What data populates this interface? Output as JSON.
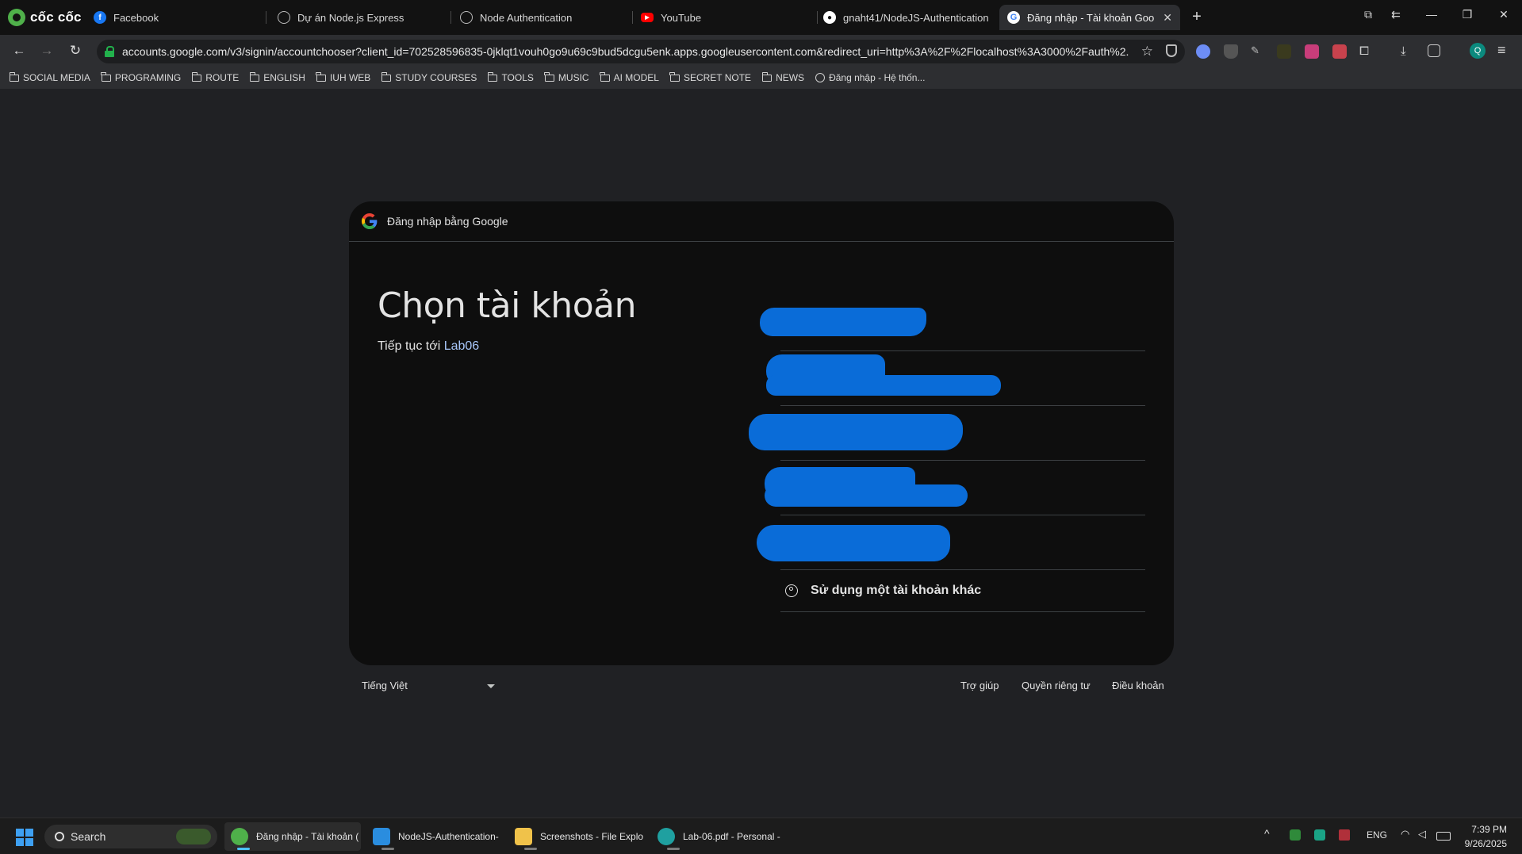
{
  "browser": {
    "brand": "cốc cốc",
    "tabs": [
      {
        "title": "Facebook",
        "icon": "facebook-icon",
        "color": "#1877f2"
      },
      {
        "title": "Dự án Node.js Express",
        "icon": "openai-icon",
        "color": "#9a9a9a"
      },
      {
        "title": "Node Authentication",
        "icon": "globe-icon",
        "color": "#9a9a9a"
      },
      {
        "title": "YouTube",
        "icon": "youtube-icon",
        "color": "#ff0000"
      },
      {
        "title": "gnaht41/NodeJS-Authentication",
        "icon": "github-icon",
        "color": "#ffffff"
      },
      {
        "title": "Đăng nhập - Tài khoản Goo",
        "icon": "google-icon",
        "color": "#ffffff",
        "active": true
      }
    ],
    "url": "accounts.google.com/v3/signin/accountchooser?client_id=702528596835-0jklqt1vouh0go9u69c9bud5dcgu5enk.apps.googleusercontent.com&redirect_uri=http%3A%2F%2Flocalhost%3A3000%2Fauth%2...",
    "avatar_letter": "Q",
    "bookmarks": [
      "SOCIAL MEDIA",
      "PROGRAMING",
      "ROUTE",
      "ENGLISH",
      "IUH WEB",
      "STUDY COURSES",
      "TOOLS",
      "MUSIC",
      "AI MODEL",
      "SECRET NOTE",
      "NEWS"
    ],
    "bookmark_site": "Đăng nhập - Hệ thốn..."
  },
  "signin": {
    "header": "Đăng nhập bằng Google",
    "title": "Chọn tài khoản",
    "subtitle_prefix": "Tiếp tục tới ",
    "app_name": "Lab06",
    "redacted_accounts": 5,
    "other_account": "Sử dụng một tài khoản khác",
    "redaction_color": "#0a6cd8"
  },
  "footer": {
    "language": "Tiếng Việt",
    "help": "Trợ giúp",
    "privacy": "Quyền riêng tư",
    "terms": "Điều khoản"
  },
  "taskbar": {
    "search": "Search",
    "apps": [
      {
        "label": "Đăng nhập - Tài khoản (",
        "icon": "coccoc-icon",
        "color": "#4fb04a",
        "active": true
      },
      {
        "label": "NodeJS-Authentication-",
        "icon": "vscode-icon",
        "color": "#2a8ddf"
      },
      {
        "label": "Screenshots - File Explo",
        "icon": "folder-icon",
        "color": "#f0c24a"
      },
      {
        "label": "Lab-06.pdf - Personal -",
        "icon": "edge-icon",
        "color": "#1fa0a0"
      }
    ],
    "lang": "ENG",
    "time": "7:39 PM",
    "date": "9/26/2025"
  }
}
